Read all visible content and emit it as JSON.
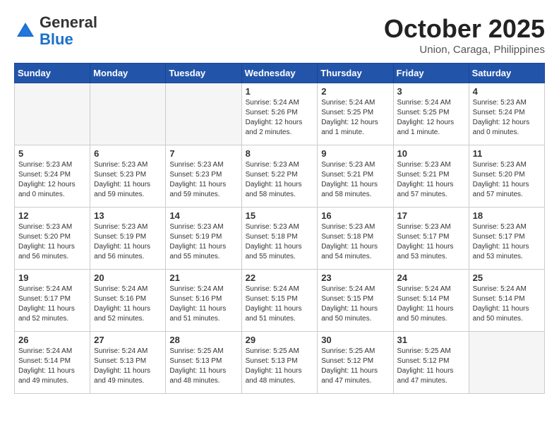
{
  "header": {
    "logo_general": "General",
    "logo_blue": "Blue",
    "month_title": "October 2025",
    "subtitle": "Union, Caraga, Philippines"
  },
  "weekdays": [
    "Sunday",
    "Monday",
    "Tuesday",
    "Wednesday",
    "Thursday",
    "Friday",
    "Saturday"
  ],
  "weeks": [
    [
      {
        "day": "",
        "info": ""
      },
      {
        "day": "",
        "info": ""
      },
      {
        "day": "",
        "info": ""
      },
      {
        "day": "1",
        "info": "Sunrise: 5:24 AM\nSunset: 5:26 PM\nDaylight: 12 hours\nand 2 minutes."
      },
      {
        "day": "2",
        "info": "Sunrise: 5:24 AM\nSunset: 5:25 PM\nDaylight: 12 hours\nand 1 minute."
      },
      {
        "day": "3",
        "info": "Sunrise: 5:24 AM\nSunset: 5:25 PM\nDaylight: 12 hours\nand 1 minute."
      },
      {
        "day": "4",
        "info": "Sunrise: 5:23 AM\nSunset: 5:24 PM\nDaylight: 12 hours\nand 0 minutes."
      }
    ],
    [
      {
        "day": "5",
        "info": "Sunrise: 5:23 AM\nSunset: 5:24 PM\nDaylight: 12 hours\nand 0 minutes."
      },
      {
        "day": "6",
        "info": "Sunrise: 5:23 AM\nSunset: 5:23 PM\nDaylight: 11 hours\nand 59 minutes."
      },
      {
        "day": "7",
        "info": "Sunrise: 5:23 AM\nSunset: 5:23 PM\nDaylight: 11 hours\nand 59 minutes."
      },
      {
        "day": "8",
        "info": "Sunrise: 5:23 AM\nSunset: 5:22 PM\nDaylight: 11 hours\nand 58 minutes."
      },
      {
        "day": "9",
        "info": "Sunrise: 5:23 AM\nSunset: 5:21 PM\nDaylight: 11 hours\nand 58 minutes."
      },
      {
        "day": "10",
        "info": "Sunrise: 5:23 AM\nSunset: 5:21 PM\nDaylight: 11 hours\nand 57 minutes."
      },
      {
        "day": "11",
        "info": "Sunrise: 5:23 AM\nSunset: 5:20 PM\nDaylight: 11 hours\nand 57 minutes."
      }
    ],
    [
      {
        "day": "12",
        "info": "Sunrise: 5:23 AM\nSunset: 5:20 PM\nDaylight: 11 hours\nand 56 minutes."
      },
      {
        "day": "13",
        "info": "Sunrise: 5:23 AM\nSunset: 5:19 PM\nDaylight: 11 hours\nand 56 minutes."
      },
      {
        "day": "14",
        "info": "Sunrise: 5:23 AM\nSunset: 5:19 PM\nDaylight: 11 hours\nand 55 minutes."
      },
      {
        "day": "15",
        "info": "Sunrise: 5:23 AM\nSunset: 5:18 PM\nDaylight: 11 hours\nand 55 minutes."
      },
      {
        "day": "16",
        "info": "Sunrise: 5:23 AM\nSunset: 5:18 PM\nDaylight: 11 hours\nand 54 minutes."
      },
      {
        "day": "17",
        "info": "Sunrise: 5:23 AM\nSunset: 5:17 PM\nDaylight: 11 hours\nand 53 minutes."
      },
      {
        "day": "18",
        "info": "Sunrise: 5:23 AM\nSunset: 5:17 PM\nDaylight: 11 hours\nand 53 minutes."
      }
    ],
    [
      {
        "day": "19",
        "info": "Sunrise: 5:24 AM\nSunset: 5:17 PM\nDaylight: 11 hours\nand 52 minutes."
      },
      {
        "day": "20",
        "info": "Sunrise: 5:24 AM\nSunset: 5:16 PM\nDaylight: 11 hours\nand 52 minutes."
      },
      {
        "day": "21",
        "info": "Sunrise: 5:24 AM\nSunset: 5:16 PM\nDaylight: 11 hours\nand 51 minutes."
      },
      {
        "day": "22",
        "info": "Sunrise: 5:24 AM\nSunset: 5:15 PM\nDaylight: 11 hours\nand 51 minutes."
      },
      {
        "day": "23",
        "info": "Sunrise: 5:24 AM\nSunset: 5:15 PM\nDaylight: 11 hours\nand 50 minutes."
      },
      {
        "day": "24",
        "info": "Sunrise: 5:24 AM\nSunset: 5:14 PM\nDaylight: 11 hours\nand 50 minutes."
      },
      {
        "day": "25",
        "info": "Sunrise: 5:24 AM\nSunset: 5:14 PM\nDaylight: 11 hours\nand 50 minutes."
      }
    ],
    [
      {
        "day": "26",
        "info": "Sunrise: 5:24 AM\nSunset: 5:14 PM\nDaylight: 11 hours\nand 49 minutes."
      },
      {
        "day": "27",
        "info": "Sunrise: 5:24 AM\nSunset: 5:13 PM\nDaylight: 11 hours\nand 49 minutes."
      },
      {
        "day": "28",
        "info": "Sunrise: 5:25 AM\nSunset: 5:13 PM\nDaylight: 11 hours\nand 48 minutes."
      },
      {
        "day": "29",
        "info": "Sunrise: 5:25 AM\nSunset: 5:13 PM\nDaylight: 11 hours\nand 48 minutes."
      },
      {
        "day": "30",
        "info": "Sunrise: 5:25 AM\nSunset: 5:12 PM\nDaylight: 11 hours\nand 47 minutes."
      },
      {
        "day": "31",
        "info": "Sunrise: 5:25 AM\nSunset: 5:12 PM\nDaylight: 11 hours\nand 47 minutes."
      },
      {
        "day": "",
        "info": ""
      }
    ]
  ]
}
